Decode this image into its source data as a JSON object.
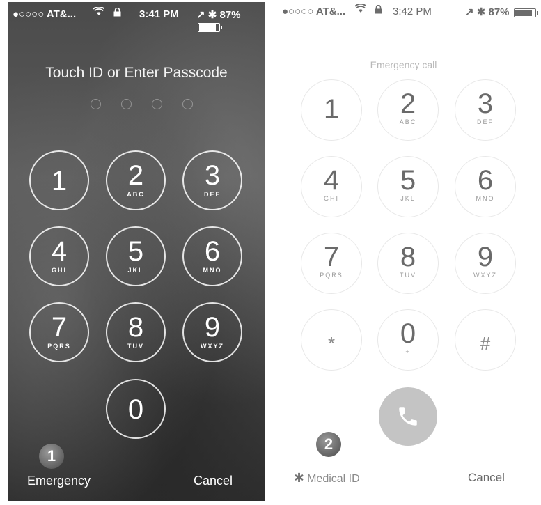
{
  "lock_screen": {
    "status_bar": {
      "carrier": "●○○○○ AT&...",
      "time": "3:41 PM",
      "battery_text": "87%",
      "location_bt": "↗ ✱"
    },
    "title": "Touch ID or Enter Passcode",
    "keys": [
      {
        "digit": "1",
        "letters": ""
      },
      {
        "digit": "2",
        "letters": "ABC"
      },
      {
        "digit": "3",
        "letters": "DEF"
      },
      {
        "digit": "4",
        "letters": "GHI"
      },
      {
        "digit": "5",
        "letters": "JKL"
      },
      {
        "digit": "6",
        "letters": "MNO"
      },
      {
        "digit": "7",
        "letters": "PQRS"
      },
      {
        "digit": "8",
        "letters": "TUV"
      },
      {
        "digit": "9",
        "letters": "WXYZ"
      },
      {
        "digit": "0",
        "letters": ""
      }
    ],
    "emergency_label": "Emergency",
    "cancel_label": "Cancel",
    "step_badge": "1"
  },
  "emergency_screen": {
    "status_bar": {
      "carrier": "●○○○○ AT&...",
      "time": "3:42 PM",
      "battery_text": "87%",
      "location_bt": "↗ ✱"
    },
    "title": "Emergency call",
    "keys": [
      {
        "digit": "1",
        "letters": ""
      },
      {
        "digit": "2",
        "letters": "ABC"
      },
      {
        "digit": "3",
        "letters": "DEF"
      },
      {
        "digit": "4",
        "letters": "GHI"
      },
      {
        "digit": "5",
        "letters": "JKL"
      },
      {
        "digit": "6",
        "letters": "MNO"
      },
      {
        "digit": "7",
        "letters": "PQRS"
      },
      {
        "digit": "8",
        "letters": "TUV"
      },
      {
        "digit": "9",
        "letters": "WXYZ"
      },
      {
        "digit": "*",
        "letters": ""
      },
      {
        "digit": "0",
        "letters": "+"
      },
      {
        "digit": "#",
        "letters": ""
      }
    ],
    "medical_id_label": "Medical ID",
    "medical_id_star": "✱",
    "cancel_label": "Cancel",
    "step_badge": "2"
  },
  "icons": {
    "wifi": "wifi-icon",
    "lock": "lock-icon",
    "battery": "battery-icon",
    "phone": "phone-icon"
  },
  "colors": {
    "call_button": "#c4c4c4",
    "badge": "#6a6a6a"
  }
}
